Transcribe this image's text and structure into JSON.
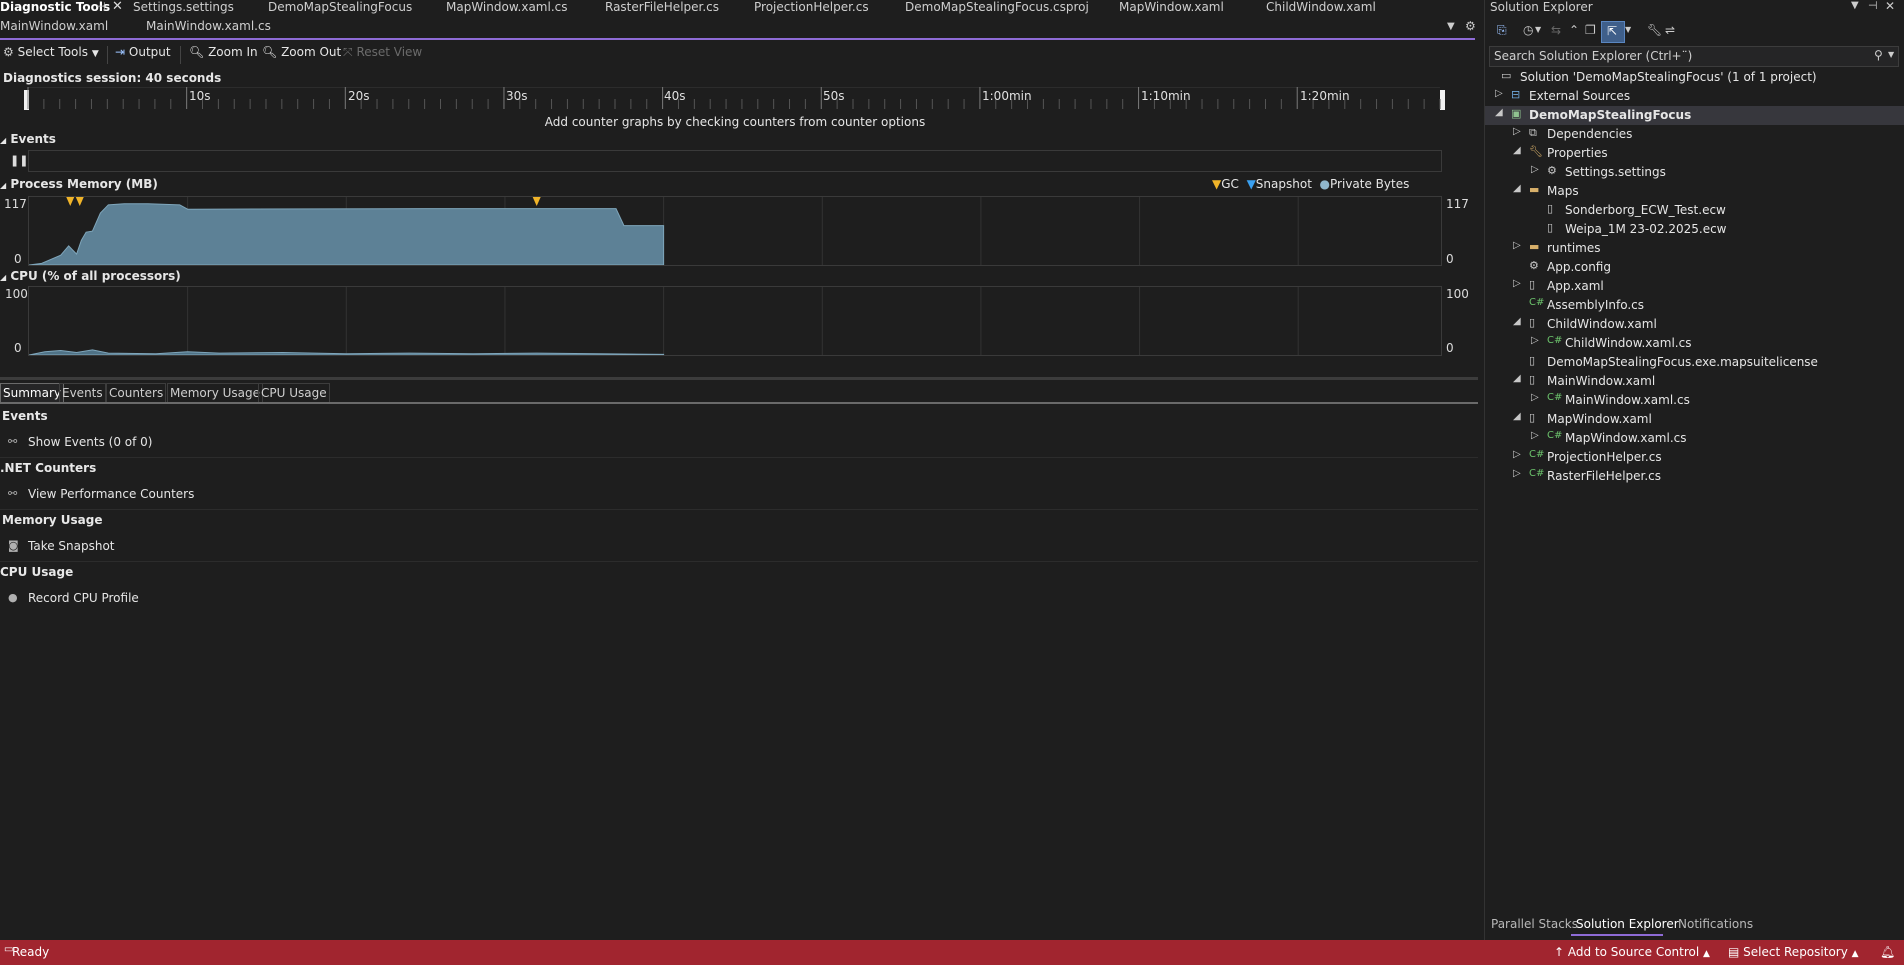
{
  "tabs_row1": [
    {
      "label": "Diagnostic Tools"
    },
    {
      "label": "Settings.settings"
    },
    {
      "label": "DemoMapStealingFocus"
    },
    {
      "label": "MapWindow.xaml.cs"
    },
    {
      "label": "RasterFileHelper.cs"
    },
    {
      "label": "ProjectionHelper.cs"
    },
    {
      "label": "DemoMapStealingFocus.csproj"
    },
    {
      "label": "MapWindow.xaml"
    },
    {
      "label": "ChildWindow.xaml"
    }
  ],
  "tabs_row2": [
    {
      "label": "MainWindow.xaml"
    },
    {
      "label": "MainWindow.xaml.cs"
    }
  ],
  "toolbar": {
    "select_tools": "Select Tools",
    "output": "Output",
    "zoom_in": "Zoom In",
    "zoom_out": "Zoom Out",
    "reset_view": "Reset View"
  },
  "session": "Diagnostics session: 40 seconds",
  "ruler": [
    "10s",
    "20s",
    "30s",
    "40s",
    "50s",
    "1:00min",
    "1:10min",
    "1:20min"
  ],
  "ruler_hint": "Add counter graphs by checking counters from counter options",
  "events_label": "Events",
  "memory": {
    "title": "Process Memory (MB)",
    "ymax": "117",
    "ymin": "0",
    "legend": {
      "gc": "GC",
      "snapshot": "Snapshot",
      "private_bytes": "Private Bytes"
    }
  },
  "cpu": {
    "title": "CPU (% of all processors)",
    "ymax": "100",
    "ymin": "0"
  },
  "chart_data": [
    {
      "type": "area",
      "title": "Process Memory (MB)",
      "ylim": [
        0,
        117
      ],
      "xlim": [
        0,
        89
      ],
      "x": [
        0,
        0.8,
        2,
        2.5,
        3,
        3.3,
        3.6,
        4,
        4.5,
        5,
        6,
        7.5,
        9.5,
        10,
        25,
        37,
        37.5,
        40
      ],
      "y": [
        0,
        3,
        18,
        35,
        20,
        45,
        60,
        62,
        95,
        110,
        112,
        112,
        110,
        102,
        103,
        103,
        72,
        72
      ],
      "gc_events_s": [
        2.6,
        3.2,
        32
      ]
    },
    {
      "type": "area",
      "title": "CPU (% of all processors)",
      "ylim": [
        0,
        100
      ],
      "xlim": [
        0,
        89
      ],
      "x": [
        0,
        1,
        2,
        3,
        4,
        5,
        8,
        10,
        12,
        16,
        20,
        24,
        28,
        32,
        36,
        40
      ],
      "y": [
        0,
        5,
        7,
        4,
        8,
        3,
        2,
        5,
        3,
        4,
        2,
        3,
        2,
        3,
        2,
        1
      ]
    }
  ],
  "summary": {
    "tabs": [
      "Summary",
      "Events",
      "Counters",
      "Memory Usage",
      "CPU Usage"
    ],
    "events_header": "Events",
    "show_events": "Show Events (0 of 0)",
    "net_header": ".NET Counters",
    "view_counters": "View Performance Counters",
    "memory_header": "Memory Usage",
    "take_snapshot": "Take Snapshot",
    "cpu_header": "CPU Usage",
    "record_cpu": "Record CPU Profile"
  },
  "solution_explorer": {
    "title": "Solution Explorer",
    "search_placeholder": "Search Solution Explorer (Ctrl+¨)",
    "tree": [
      {
        "label": "Solution 'DemoMapStealingFocus' (1 of 1 project)"
      },
      {
        "label": "External Sources"
      },
      {
        "label": "DemoMapStealingFocus"
      },
      {
        "label": "Dependencies"
      },
      {
        "label": "Properties"
      },
      {
        "label": "Settings.settings"
      },
      {
        "label": "Maps"
      },
      {
        "label": "Sonderborg_ECW_Test.ecw"
      },
      {
        "label": "Weipa_1M 23-02.2025.ecw"
      },
      {
        "label": "runtimes"
      },
      {
        "label": "App.config"
      },
      {
        "label": "App.xaml"
      },
      {
        "label": "AssemblyInfo.cs"
      },
      {
        "label": "ChildWindow.xaml"
      },
      {
        "label": "ChildWindow.xaml.cs"
      },
      {
        "label": "DemoMapStealingFocus.exe.mapsuitelicense"
      },
      {
        "label": "MainWindow.xaml"
      },
      {
        "label": "MainWindow.xaml.cs"
      },
      {
        "label": "MapWindow.xaml"
      },
      {
        "label": "MapWindow.xaml.cs"
      },
      {
        "label": "ProjectionHelper.cs"
      },
      {
        "label": "RasterFileHelper.cs"
      }
    ],
    "bottom_tabs": [
      "Parallel Stacks",
      "Solution Explorer",
      "Notifications"
    ]
  },
  "status": {
    "ready": "Ready",
    "add_source": "Add to Source Control",
    "select_repo": "Select Repository"
  },
  "colors": {
    "accent": "#8e6bd6",
    "status_bar": "#a1252f",
    "memory_fill": "#5d8196",
    "gc_marker": "#f0b429",
    "snapshot_marker": "#3aa0f0"
  }
}
